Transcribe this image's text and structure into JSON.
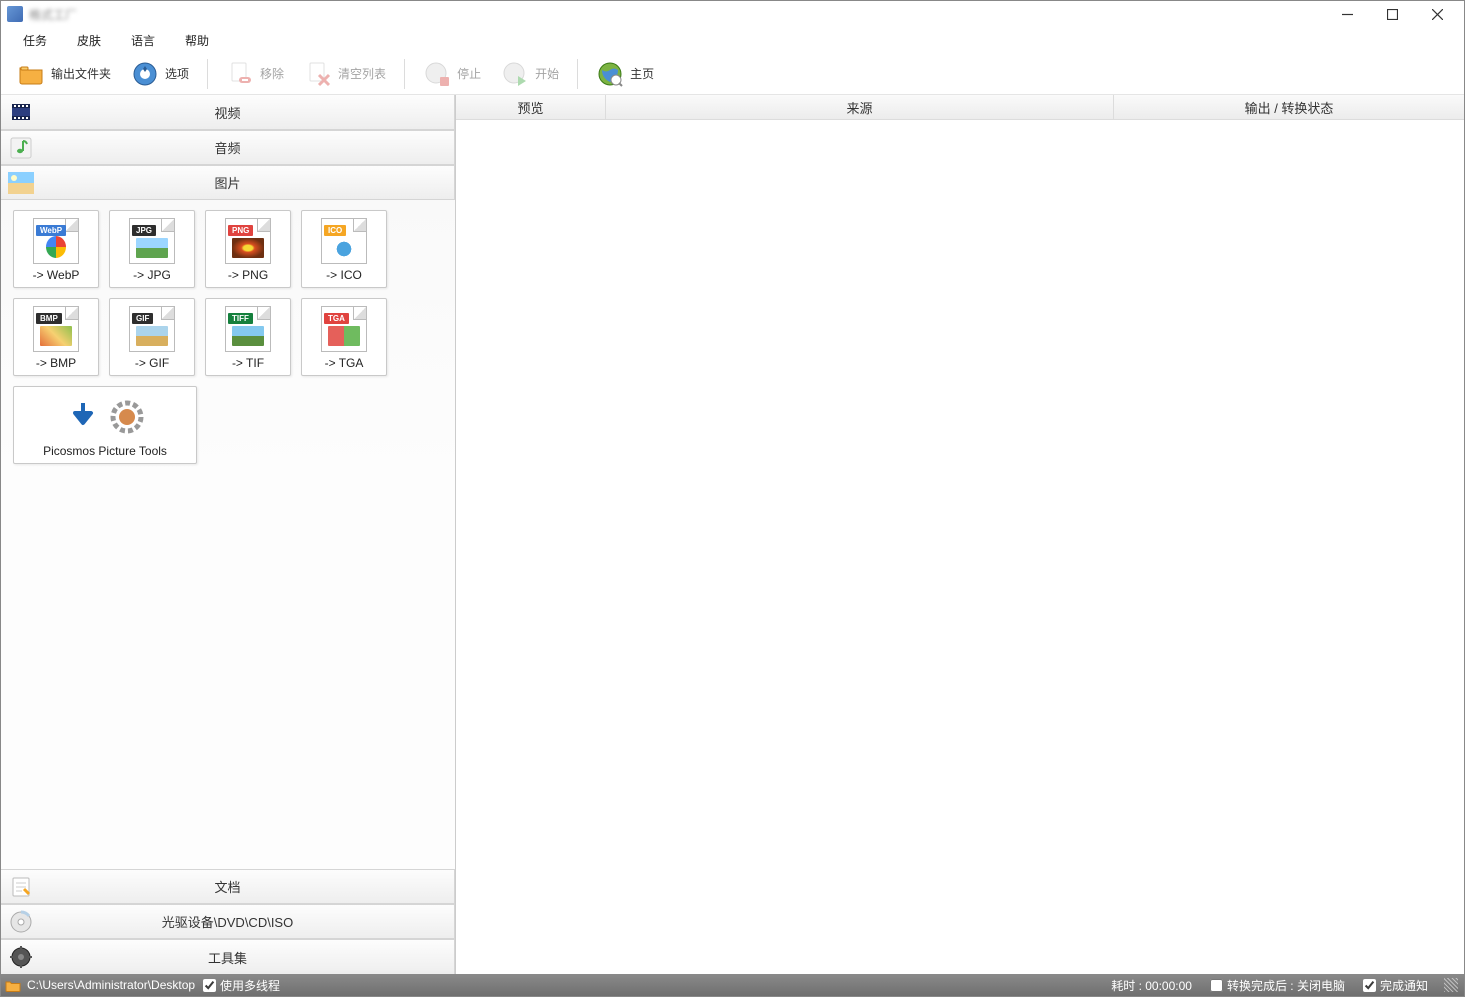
{
  "title": "格式工厂",
  "menu": {
    "task": "任务",
    "skin": "皮肤",
    "language": "语言",
    "help": "帮助"
  },
  "toolbar": {
    "outputFolder": "输出文件夹",
    "options": "选项",
    "remove": "移除",
    "clearList": "清空列表",
    "stop": "停止",
    "start": "开始",
    "home": "主页"
  },
  "categories": {
    "video": "视频",
    "audio": "音频",
    "image": "图片",
    "document": "文档",
    "disc": "光驱设备\\DVD\\CD\\ISO",
    "tools": "工具集"
  },
  "formats": [
    {
      "label": "-> WebP",
      "badge": "WebP",
      "badgeColor": "#3a7bd5",
      "thumb": "chrome"
    },
    {
      "label": "-> JPG",
      "badge": "JPG",
      "badgeColor": "#2e2e2e",
      "thumb": "photo1"
    },
    {
      "label": "-> PNG",
      "badge": "PNG",
      "badgeColor": "#e0433f",
      "thumb": "flower"
    },
    {
      "label": "-> ICO",
      "badge": "ICO",
      "badgeColor": "#f5a623",
      "thumb": "info"
    },
    {
      "label": "-> BMP",
      "badge": "BMP",
      "badgeColor": "#2e2e2e",
      "thumb": "art"
    },
    {
      "label": "-> GIF",
      "badge": "GIF",
      "badgeColor": "#2e2e2e",
      "thumb": "photo2"
    },
    {
      "label": "-> TIF",
      "badge": "TIFF",
      "badgeColor": "#15803d",
      "thumb": "photo3"
    },
    {
      "label": "-> TGA",
      "badge": "TGA",
      "badgeColor": "#e0433f",
      "thumb": "shapes"
    }
  ],
  "picosmos": "Picosmos Picture Tools",
  "columns": {
    "preview": "预览",
    "source": "来源",
    "status": "输出 / 转换状态"
  },
  "status": {
    "path": "C:\\Users\\Administrator\\Desktop",
    "multithread": "使用多线程",
    "elapsedLabel": "耗时 : ",
    "elapsed": "00:00:00",
    "afterConvert": "转换完成后 : 关闭电脑",
    "notify": "完成通知"
  }
}
